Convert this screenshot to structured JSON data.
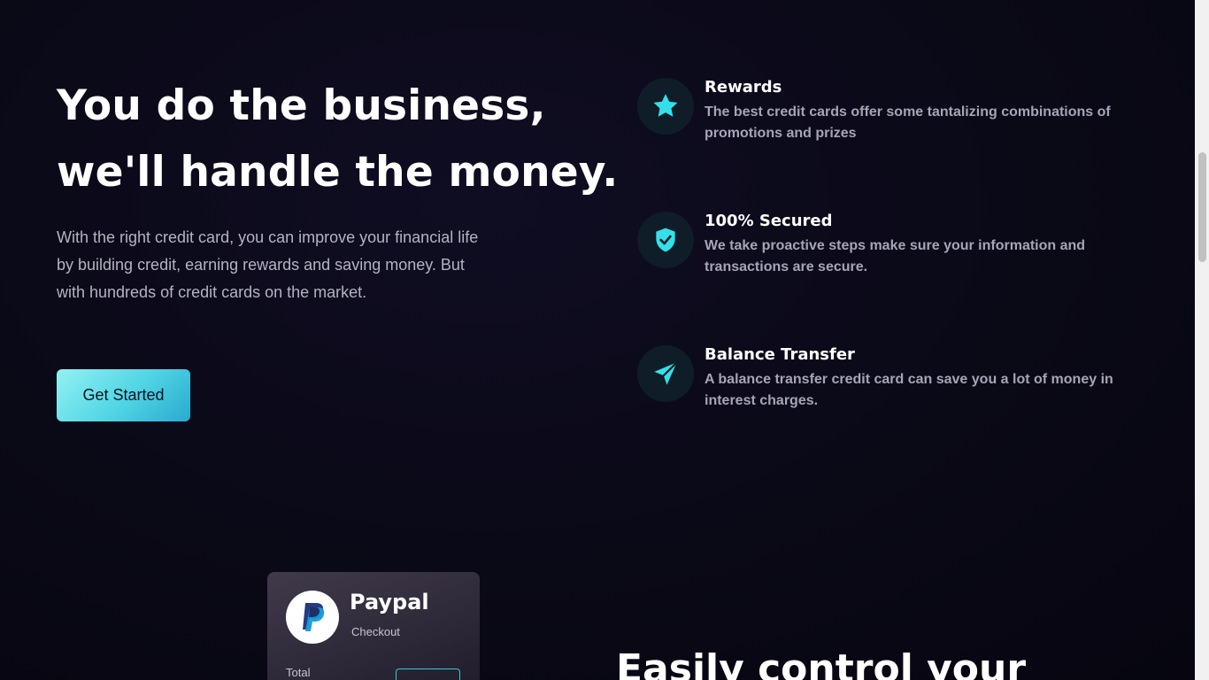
{
  "hero": {
    "title_line1": "You do the business,",
    "title_line2": "we'll handle the money.",
    "description": "With the right credit card, you can improve your financial life by building credit, earning rewards and saving money. But with hundreds of credit cards on the market.",
    "cta_label": "Get Started"
  },
  "features": [
    {
      "icon": "star-icon",
      "title": "Rewards",
      "text": "The best credit cards offer some tantalizing combinations of promotions and prizes"
    },
    {
      "icon": "shield-icon",
      "title": "100% Secured",
      "text": "We take proactive steps make sure your information and transactions are secure."
    },
    {
      "icon": "send-icon",
      "title": "Balance Transfer",
      "text": "A balance transfer credit card can save you a lot of money in interest charges."
    }
  ],
  "payment_card": {
    "brand": "Paypal",
    "subtitle": "Checkout",
    "total_label": "Total",
    "logo_icon": "paypal-logo"
  },
  "section": {
    "title": "Easily control your"
  },
  "colors": {
    "accent": "#33e0ea",
    "background": "#0b0a17",
    "icon_bg": "#0e1d27",
    "muted_text": "#a6a5b7"
  }
}
